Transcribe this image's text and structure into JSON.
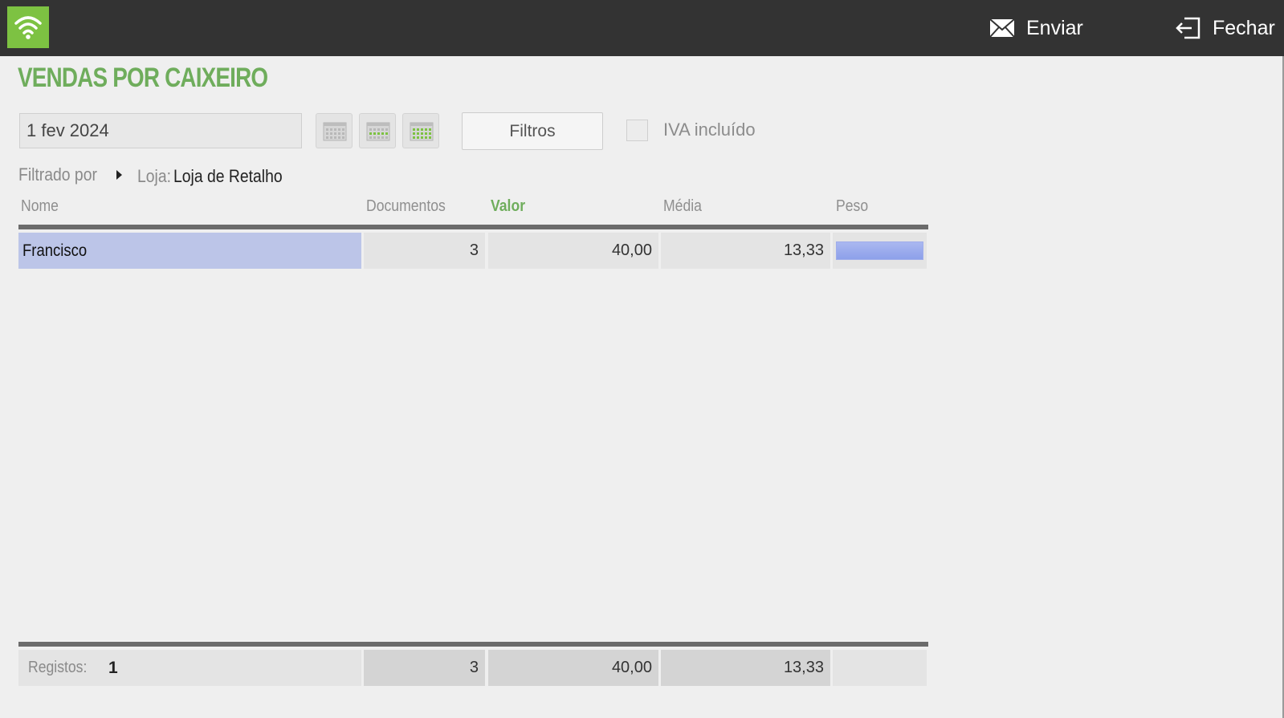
{
  "header": {
    "send_label": "Enviar",
    "close_label": "Fechar"
  },
  "page": {
    "title": "VENDAS POR CAIXEIRO"
  },
  "toolbar": {
    "date_value": "1 fev 2024",
    "filters_label": "Filtros",
    "vat_label": "IVA incluído",
    "vat_checked": false
  },
  "filter_info": {
    "prefix": "Filtrado por",
    "store_key": "Loja:",
    "store_value": "Loja de Retalho"
  },
  "table": {
    "columns": [
      "Nome",
      "Documentos",
      "Valor",
      "Média",
      "Peso"
    ],
    "sorted_column": "Valor",
    "rows": [
      {
        "name": "Francisco",
        "documents": "3",
        "value": "40,00",
        "average": "13,33",
        "weight": 1.0
      }
    ],
    "footer": {
      "records_label": "Registos:",
      "records_count": "1",
      "documents_total": "3",
      "value_total": "40,00",
      "average_total": "13,33"
    }
  },
  "colors": {
    "accent_green": "#6fad5c",
    "topbar": "#333333",
    "app_icon": "#7dc242",
    "selection": "#bcc5e8",
    "weight_bar": "#8da0ea"
  }
}
